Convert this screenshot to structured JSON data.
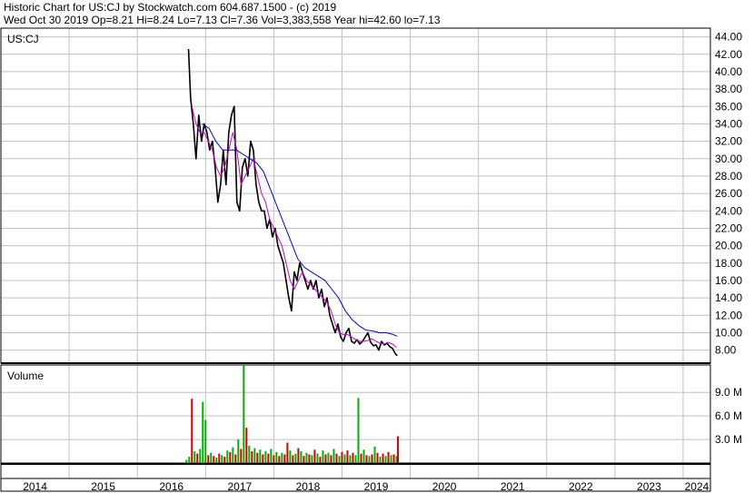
{
  "header": {
    "line1": "Historic Chart for US:CJ by Stockwatch.com 604.687.1500 - (c) 2019",
    "line2": "Wed Oct 30 2019   Op=8.21  Hi=8.24  Lo=7.13  Cl=7.36  Vol=3,383,558  Year hi=42.60  lo=7.13"
  },
  "colors": {
    "background": "#ffffff",
    "grid": "#c0c0c0",
    "price": "#000000",
    "ma_short": "#d000d0",
    "ma_long": "#0000cc",
    "volume_up": "#00b000",
    "volume_down": "#d00000"
  },
  "chart_data": [
    {
      "type": "line",
      "symbol_label": "US:CJ",
      "y_ticks": [
        "44.00",
        "42.00",
        "40.00",
        "38.00",
        "36.00",
        "34.00",
        "32.00",
        "30.00",
        "28.00",
        "26.00",
        "24.00",
        "22.00",
        "20.00",
        "18.00",
        "16.00",
        "14.00",
        "12.00",
        "10.00",
        "8.00"
      ],
      "ylim": [
        6.5,
        45
      ],
      "x_ticks": [
        "2014",
        "2015",
        "2016",
        "2017",
        "2018",
        "2019",
        "2020",
        "2021",
        "2022",
        "2023",
        "2024"
      ],
      "xlim": [
        2014.0,
        2024.4
      ],
      "series": [
        {
          "x": [
            2016.75,
            2016.78,
            2016.82,
            2016.86,
            2016.9,
            2016.94,
            2016.98,
            2017.02,
            2017.06,
            2017.1,
            2017.14,
            2017.18,
            2017.22,
            2017.26,
            2017.3,
            2017.34,
            2017.38,
            2017.42,
            2017.46,
            2017.5,
            2017.54,
            2017.58,
            2017.62,
            2017.66,
            2017.7,
            2017.74,
            2017.78,
            2017.82,
            2017.86,
            2017.9,
            2017.94,
            2017.98,
            2018.02,
            2018.06,
            2018.1,
            2018.14,
            2018.18,
            2018.22,
            2018.26,
            2018.3,
            2018.34,
            2018.38,
            2018.42,
            2018.46,
            2018.5,
            2018.54,
            2018.58,
            2018.62,
            2018.66,
            2018.7,
            2018.74,
            2018.78,
            2018.82,
            2018.86,
            2018.9,
            2018.94,
            2018.98,
            2019.02,
            2019.06,
            2019.1,
            2019.14,
            2019.18,
            2019.22,
            2019.26,
            2019.3,
            2019.34,
            2019.38,
            2019.42,
            2019.46,
            2019.5,
            2019.54,
            2019.58,
            2019.62,
            2019.66,
            2019.7,
            2019.74,
            2019.78,
            2019.81
          ],
          "values": [
            42.6,
            37,
            34,
            30,
            35,
            32,
            34,
            33,
            31,
            32,
            29,
            25,
            27,
            31,
            27,
            33,
            35,
            36,
            25,
            24,
            29,
            30,
            28,
            32,
            31,
            27,
            25,
            24,
            24,
            22,
            23,
            21,
            22,
            20,
            19,
            18,
            16,
            14,
            12.5,
            17,
            16,
            18,
            17,
            16,
            15,
            16,
            15,
            16,
            14,
            15,
            13,
            14,
            12,
            11,
            10,
            11,
            9.5,
            9,
            10,
            10.5,
            9,
            8.8,
            9.2,
            8.7,
            9,
            9.5,
            10,
            8.9,
            8.5,
            8.6,
            8,
            9,
            8.6,
            8.8,
            8.4,
            8.2,
            7.6,
            7.36
          ]
        },
        {
          "x": [
            2016.8,
            2016.86,
            2016.92,
            2016.98,
            2017.04,
            2017.1,
            2017.16,
            2017.22,
            2017.28,
            2017.34,
            2017.4,
            2017.46,
            2017.52,
            2017.58,
            2017.64,
            2017.7,
            2017.76,
            2017.82,
            2017.88,
            2017.94,
            2018.0,
            2018.06,
            2018.12,
            2018.18,
            2018.24,
            2018.3,
            2018.36,
            2018.42,
            2018.48,
            2018.54,
            2018.6,
            2018.66,
            2018.72,
            2018.78,
            2018.84,
            2018.9,
            2018.96,
            2019.02,
            2019.08,
            2019.14,
            2019.2,
            2019.26,
            2019.32,
            2019.38,
            2019.44,
            2019.5,
            2019.56,
            2019.62,
            2019.68,
            2019.74,
            2019.8
          ],
          "values": [
            36,
            34,
            33,
            33,
            32,
            31,
            29,
            28,
            29,
            31,
            33,
            31,
            27,
            28,
            29,
            30,
            28,
            26,
            25,
            23,
            22,
            21,
            20,
            18,
            16,
            15,
            16,
            17,
            16,
            15.5,
            15,
            14.5,
            14,
            13.5,
            12.5,
            11,
            10,
            9.8,
            9.8,
            9.5,
            9.2,
            9,
            9,
            9.1,
            9.3,
            9,
            8.8,
            8.7,
            8.9,
            8.7,
            8.3
          ]
        },
        {
          "x": [
            2016.95,
            2017.05,
            2017.15,
            2017.25,
            2017.35,
            2017.45,
            2017.55,
            2017.65,
            2017.75,
            2017.85,
            2017.95,
            2018.05,
            2018.15,
            2018.25,
            2018.35,
            2018.45,
            2018.55,
            2018.65,
            2018.75,
            2018.85,
            2018.95,
            2019.05,
            2019.15,
            2019.25,
            2019.35,
            2019.45,
            2019.55,
            2019.65,
            2019.75,
            2019.81
          ],
          "values": [
            34,
            33.5,
            32,
            31,
            31,
            31,
            30.5,
            30,
            29.5,
            28.5,
            26.5,
            24.5,
            22.5,
            20.5,
            18.5,
            17.5,
            17,
            16.5,
            16,
            15,
            14,
            12.5,
            11.5,
            10.8,
            10.3,
            10.2,
            10,
            10,
            9.8,
            9.6
          ]
        }
      ]
    },
    {
      "type": "bar",
      "title": "Volume",
      "y_ticks": [
        "9.0 M",
        "6.0 M",
        "3.0 M"
      ],
      "ylim": [
        0,
        12.5
      ],
      "unit": "M",
      "x": [
        2016.72,
        2016.76,
        2016.8,
        2016.84,
        2016.88,
        2016.92,
        2016.96,
        2017.0,
        2017.04,
        2017.08,
        2017.12,
        2017.16,
        2017.2,
        2017.24,
        2017.28,
        2017.32,
        2017.36,
        2017.4,
        2017.44,
        2017.48,
        2017.52,
        2017.56,
        2017.6,
        2017.64,
        2017.68,
        2017.72,
        2017.76,
        2017.8,
        2017.84,
        2017.88,
        2017.92,
        2017.96,
        2018.0,
        2018.04,
        2018.08,
        2018.12,
        2018.16,
        2018.2,
        2018.24,
        2018.28,
        2018.32,
        2018.36,
        2018.4,
        2018.44,
        2018.48,
        2018.52,
        2018.56,
        2018.6,
        2018.64,
        2018.68,
        2018.72,
        2018.76,
        2018.8,
        2018.84,
        2018.88,
        2018.92,
        2018.96,
        2019.0,
        2019.04,
        2019.08,
        2019.12,
        2019.16,
        2019.2,
        2019.24,
        2019.28,
        2019.32,
        2019.36,
        2019.4,
        2019.44,
        2019.48,
        2019.52,
        2019.56,
        2019.6,
        2019.64,
        2019.68,
        2019.72,
        2019.76,
        2019.8,
        2019.82
      ],
      "values": [
        0.4,
        0.8,
        8.2,
        1.5,
        1.2,
        1.8,
        7.8,
        5.5,
        1.0,
        1.3,
        0.9,
        0.7,
        1.2,
        1.0,
        0.8,
        1.6,
        1.4,
        2.0,
        1.1,
        3.0,
        1.8,
        12.5,
        4.5,
        2.2,
        1.5,
        1.9,
        1.3,
        1.7,
        1.1,
        1.5,
        1.2,
        1.8,
        1.0,
        1.4,
        0.9,
        1.3,
        1.1,
        2.6,
        1.6,
        1.0,
        1.2,
        1.9,
        1.5,
        0.9,
        1.3,
        1.1,
        1.0,
        1.7,
        1.2,
        0.8,
        1.6,
        1.1,
        1.3,
        1.0,
        1.8,
        1.2,
        0.9,
        1.4,
        1.1,
        1.6,
        1.0,
        1.3,
        1.0,
        8.3,
        1.2,
        1.7,
        1.0,
        0.9,
        1.1,
        2.1,
        1.3,
        0.8,
        1.2,
        0.9,
        1.4,
        1.0,
        1.1,
        0.9,
        3.4
      ],
      "direction": [
        "u",
        "u",
        "d",
        "u",
        "d",
        "u",
        "u",
        "u",
        "d",
        "u",
        "d",
        "u",
        "d",
        "u",
        "d",
        "u",
        "d",
        "u",
        "d",
        "u",
        "d",
        "u",
        "d",
        "u",
        "d",
        "u",
        "d",
        "u",
        "d",
        "u",
        "d",
        "u",
        "d",
        "u",
        "d",
        "u",
        "d",
        "d",
        "u",
        "d",
        "u",
        "d",
        "u",
        "d",
        "u",
        "d",
        "u",
        "d",
        "u",
        "d",
        "u",
        "d",
        "u",
        "d",
        "u",
        "d",
        "u",
        "d",
        "u",
        "d",
        "u",
        "d",
        "u",
        "u",
        "d",
        "u",
        "d",
        "u",
        "d",
        "u",
        "d",
        "u",
        "d",
        "u",
        "d",
        "u",
        "d",
        "u",
        "d"
      ]
    }
  ]
}
